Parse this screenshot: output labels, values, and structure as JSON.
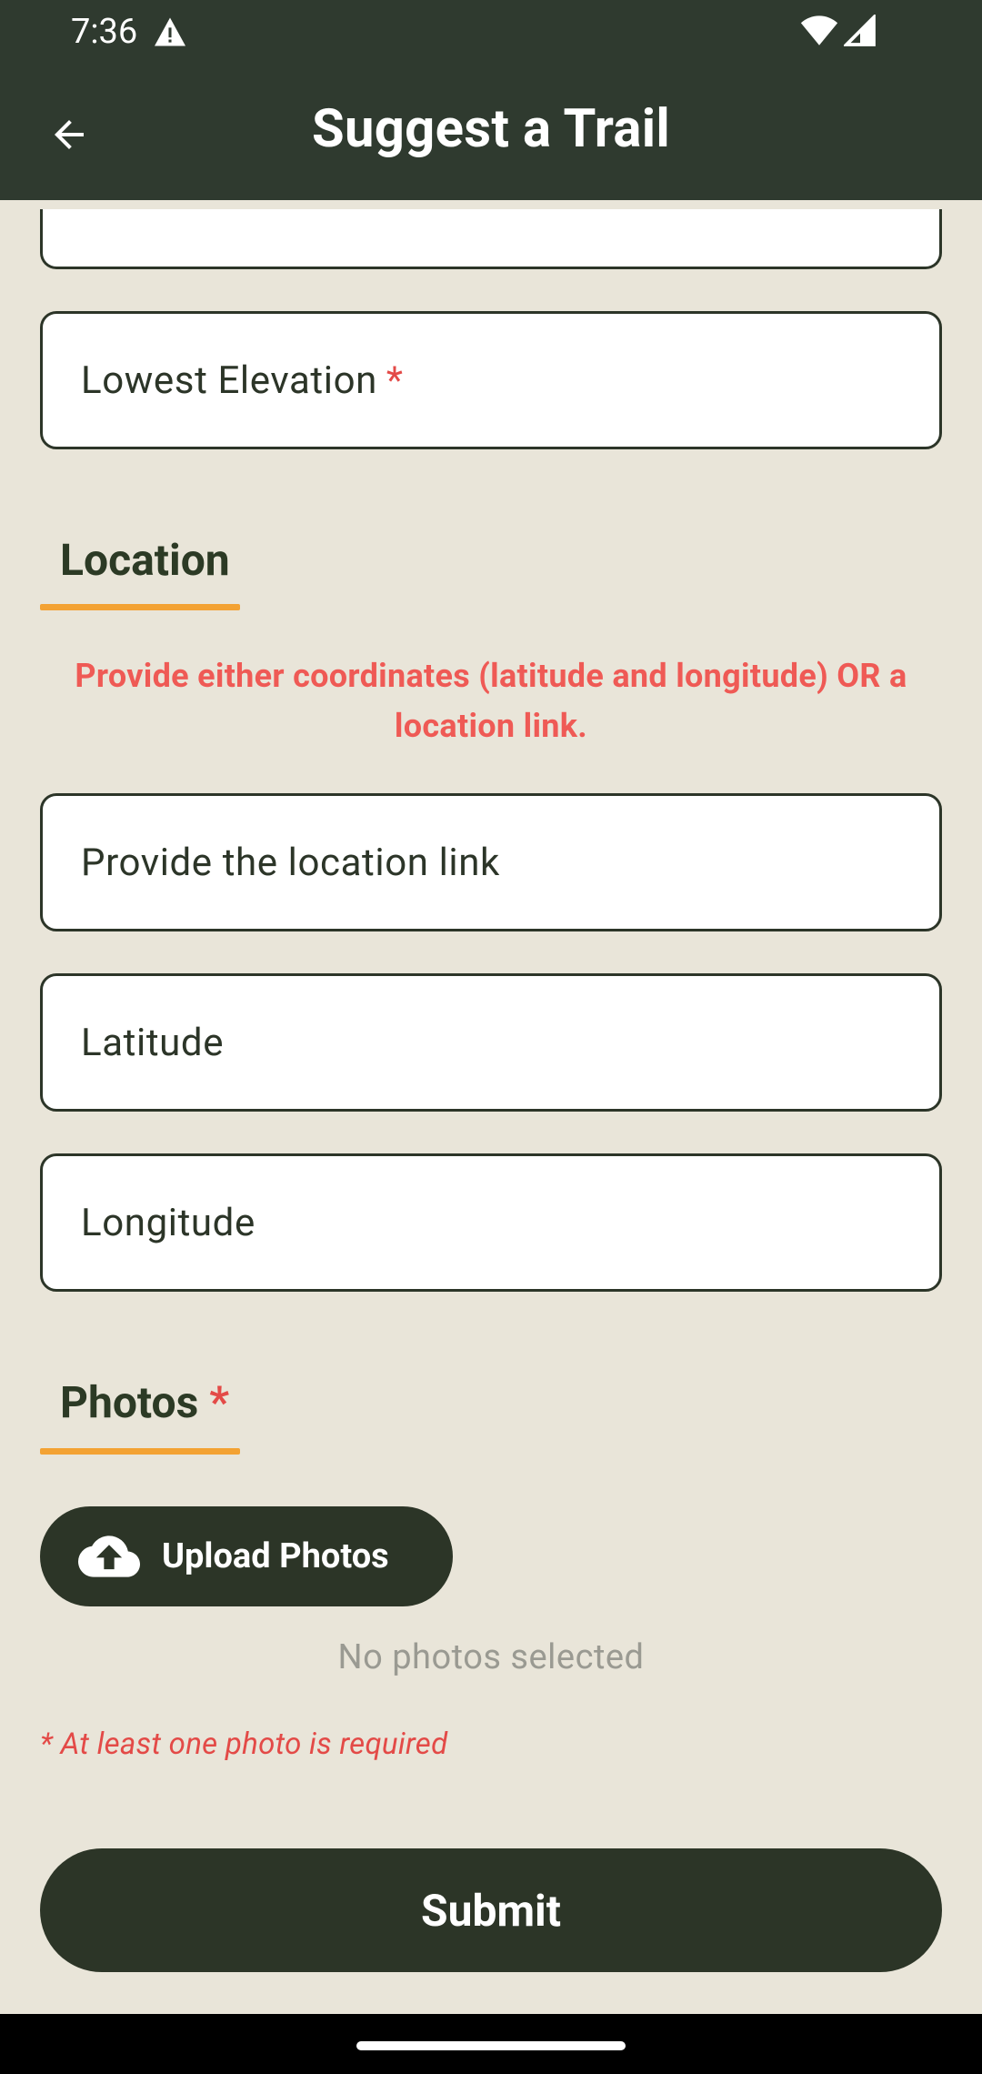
{
  "status_bar": {
    "time": "7:36",
    "icons": [
      "warning-icon",
      "wifi-icon",
      "cellular-signal-icon"
    ]
  },
  "app_bar": {
    "title": "Suggest a Trail",
    "back_icon": "arrow-left-icon"
  },
  "form": {
    "lowest_elevation": {
      "label": "Lowest Elevation",
      "required_mark": "*"
    },
    "location": {
      "title": "Location",
      "hint": "Provide either coordinates (latitude and longitude) OR a location link.",
      "link_placeholder": "Provide the location link",
      "latitude_placeholder": "Latitude",
      "longitude_placeholder": "Longitude"
    },
    "photos": {
      "title": "Photos",
      "required_mark": "*",
      "upload_label": "Upload Photos",
      "upload_icon": "cloud-upload-icon",
      "empty_text": "No photos selected",
      "requirement_text": "* At least one photo is required"
    },
    "submit_label": "Submit"
  },
  "colors": {
    "app_bar": "#2f3a2f",
    "background": "#e9e5d9",
    "accent_underline": "#f3a233",
    "error": "#e34a47",
    "button": "#2c3527"
  }
}
